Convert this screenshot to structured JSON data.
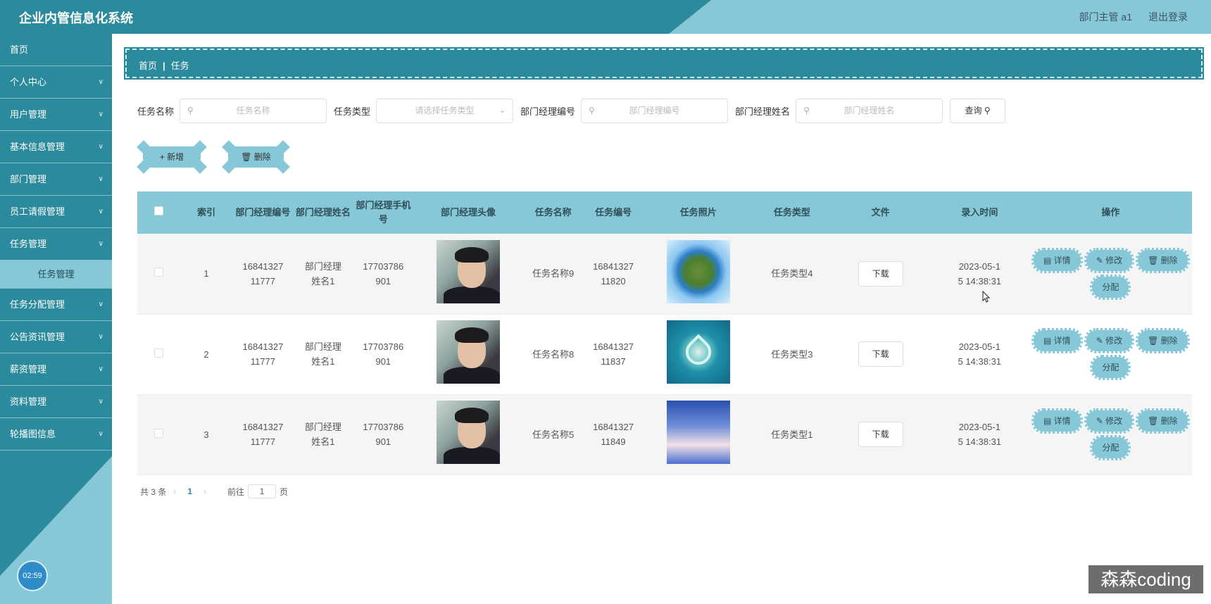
{
  "header": {
    "title": "企业内管信息化系统",
    "user": "部门主管 a1",
    "logout": "退出登录"
  },
  "sidebar": {
    "items": [
      {
        "label": "首页",
        "has_arrow": false
      },
      {
        "label": "个人中心",
        "has_arrow": true
      },
      {
        "label": "用户管理",
        "has_arrow": true
      },
      {
        "label": "基本信息管理",
        "has_arrow": true
      },
      {
        "label": "部门管理",
        "has_arrow": true
      },
      {
        "label": "员工请假管理",
        "has_arrow": true
      },
      {
        "label": "任务管理",
        "has_arrow": true
      },
      {
        "label": "任务分配管理",
        "has_arrow": true
      },
      {
        "label": "公告资讯管理",
        "has_arrow": true
      },
      {
        "label": "薪资管理",
        "has_arrow": true
      },
      {
        "label": "资料管理",
        "has_arrow": true
      },
      {
        "label": "轮播图信息",
        "has_arrow": true
      }
    ],
    "active_sub": "任务管理",
    "timer": "02:59"
  },
  "breadcrumb": {
    "home": "首页",
    "current": "任务"
  },
  "search": {
    "task_name_label": "任务名称",
    "task_name_placeholder": "任务名称",
    "task_type_label": "任务类型",
    "task_type_placeholder": "请选择任务类型",
    "mgr_no_label": "部门经理编号",
    "mgr_no_placeholder": "部门经理编号",
    "mgr_name_label": "部门经理姓名",
    "mgr_name_placeholder": "部门经理姓名",
    "query": "查询"
  },
  "actions": {
    "add": "新增",
    "delete": "删除"
  },
  "table": {
    "headers": [
      "索引",
      "部门经理编号",
      "部门经理姓名",
      "部门经理手机号",
      "部门经理头像",
      "任务名称",
      "任务编号",
      "任务照片",
      "任务类型",
      "文件",
      "录入时间",
      "操作"
    ],
    "rows": [
      {
        "index": "1",
        "mgr_no": "1684132711777",
        "mgr_name": "部门经理姓名1",
        "phone": "17703786901",
        "task_name": "任务名称9",
        "task_no": "1684132711820",
        "task_type": "任务类型4",
        "time": "2023-05-15 14:38:31"
      },
      {
        "index": "2",
        "mgr_no": "1684132711777",
        "mgr_name": "部门经理姓名1",
        "phone": "17703786901",
        "task_name": "任务名称8",
        "task_no": "1684132711837",
        "task_type": "任务类型3",
        "time": "2023-05-15 14:38:31"
      },
      {
        "index": "3",
        "mgr_no": "1684132711777",
        "mgr_name": "部门经理姓名1",
        "phone": "17703786901",
        "task_name": "任务名称5",
        "task_no": "1684132711849",
        "task_type": "任务类型1",
        "time": "2023-05-15 14:38:31"
      }
    ],
    "download": "下载",
    "op_detail": "详情",
    "op_edit": "修改",
    "op_delete": "删除",
    "op_assign": "分配"
  },
  "pager": {
    "total": "共 3 条",
    "page": "1",
    "goto": "前往",
    "goto_value": "1",
    "page_unit": "页"
  },
  "watermark": "森森coding",
  "colors": {
    "primary": "#2b8a9b",
    "accent": "#87c8d8"
  }
}
